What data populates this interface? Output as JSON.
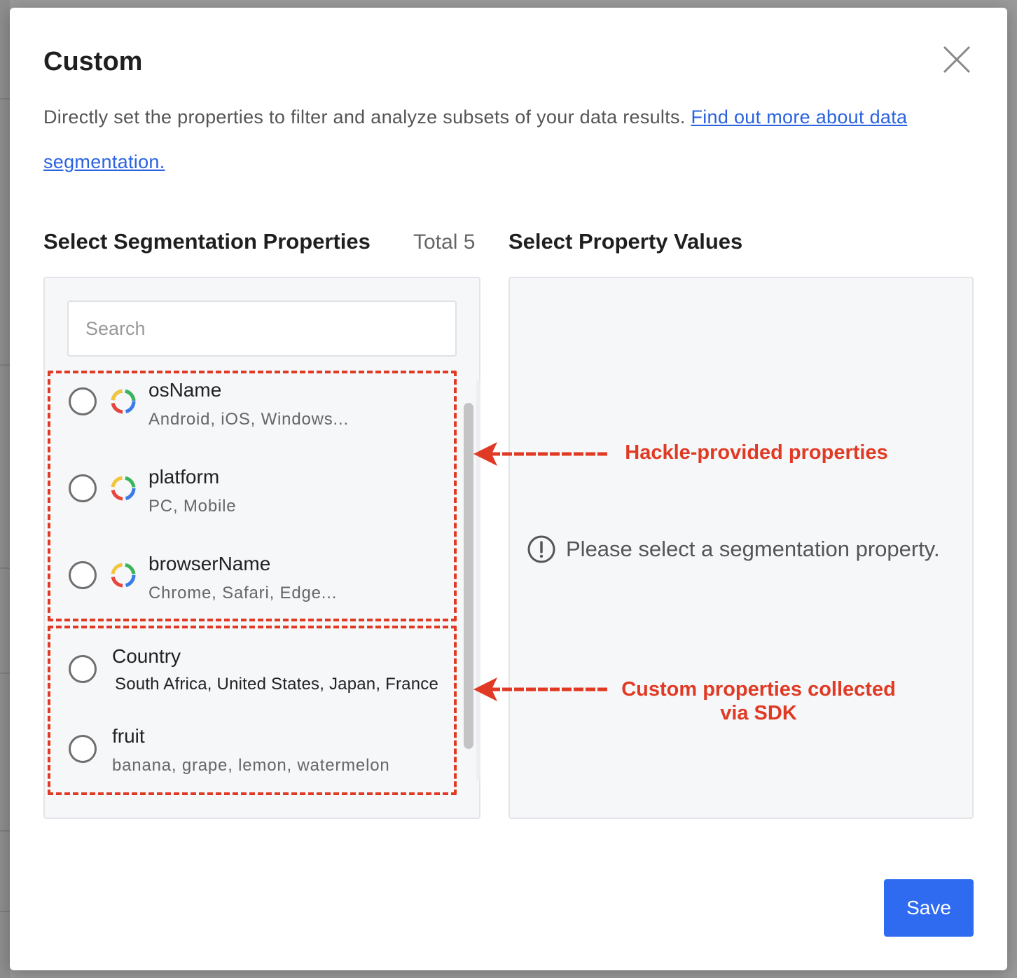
{
  "dialog": {
    "title": "Custom",
    "description": "Directly set the properties to filter and analyze subsets of your data results. ",
    "link_text": "Find out more about data segmentation.",
    "save_label": "Save"
  },
  "properties_panel": {
    "heading": "Select Segmentation Properties",
    "total": "Total 5",
    "search_placeholder": "Search",
    "items": [
      {
        "name": "osName",
        "values": "Android, iOS, Windows...",
        "icon": "hackle-icon"
      },
      {
        "name": "platform",
        "values": "PC, Mobile",
        "icon": "hackle-icon"
      },
      {
        "name": "browserName",
        "values": "Chrome, Safari, Edge...",
        "icon": "hackle-icon"
      },
      {
        "name": "Country",
        "values": "South Africa, United States, Japan, France"
      },
      {
        "name": "fruit",
        "values": "banana, grape, lemon, watermelon"
      }
    ]
  },
  "values_panel": {
    "heading": "Select Property Values",
    "empty_message": "Please select a segmentation property."
  },
  "annotations": {
    "hackle": "Hackle-provided properties",
    "custom_line1": "Custom properties collected",
    "custom_line2": "via SDK",
    "color": "#e03a24"
  },
  "colors": {
    "accent": "#2f6bf0",
    "link": "#2a63e0"
  }
}
